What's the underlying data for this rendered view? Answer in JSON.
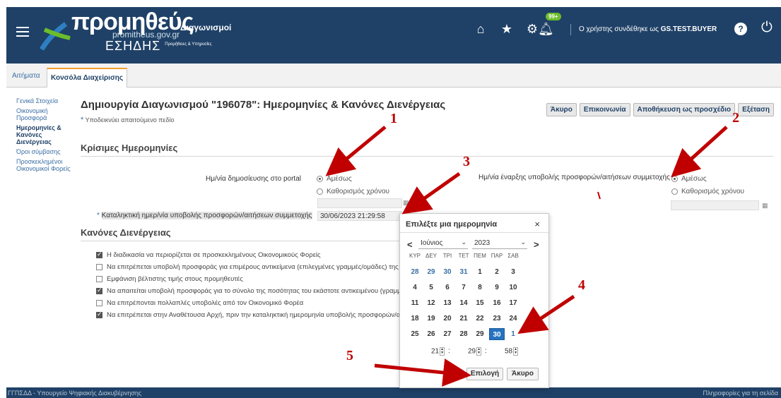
{
  "header": {
    "logo_main": "προμηθεύς",
    "logo_sub": "Διαγωνισμοί",
    "logo_url": "promitheus.gov.gr",
    "logo_esidis": "ΕΣΗΔΗΣ",
    "logo_esidis_small": "Προμήθειες & Υπηρεσίες",
    "notification_badge": "99+",
    "user_prefix": "Ο χρήστης συνδέθηκε ως ",
    "user_name": "GS.TEST.BUYER",
    "help_label": "?",
    "icons": [
      "home-icon",
      "star-icon",
      "gear-icon",
      "bell-icon",
      "help-icon",
      "power-icon"
    ]
  },
  "tabs": [
    {
      "label": "Αιτήματα"
    },
    {
      "label": "Κονσόλα Διαχείρισης",
      "active": true
    }
  ],
  "sidebar": {
    "items": [
      {
        "label": "Γενικά Στοιχεία"
      },
      {
        "label": "Οικονομική Προσφορά"
      },
      {
        "label": "Ημερομηνίες & Κανόνες Διενέργειας",
        "current": true
      },
      {
        "label": "Όροι σύμβασης"
      },
      {
        "label": "Προσκεκλημένοι Οικονομικοί Φορείς"
      }
    ]
  },
  "page": {
    "title": "Δημιουργία Διαγωνισμού \"196078\": Ημερομηνίες & Κανόνες Διενέργειας",
    "required_note": "Υποδεικνύει απαιτούμενο πεδίο",
    "buttons": {
      "cancel": "Άκυρο",
      "contact": "Επικοινωνία",
      "save_draft": "Αποθήκευση ως προσχέδιο",
      "review": "Εξέταση"
    }
  },
  "key_dates": {
    "heading": "Κρίσιμες Ημερομηνίες",
    "publish_label": "Ημ/νία δημοσίευσης στο portal",
    "submit_start_label": "Ημ/νία έναρξης υποβολής προσφορών/αιτήσεων συμμετοχής",
    "option_immediate": "Αμέσως",
    "option_scheduled": "Καθορισμός χρόνου",
    "deadline_label": "Καταληκτική ημερ/νία υποβολής προσφορών/αιτήσεων συμμετοχής",
    "deadline_value": "30/06/2023 21:29:58"
  },
  "rules": {
    "heading": "Κανόνες Διενέργειας",
    "items": [
      {
        "label": "Η διαδικασία να περιορίζεται σε προσκεκλημένους Οικονομικούς Φορείς",
        "checked": true
      },
      {
        "label": "Να επιτρέπεται υποβολή προσφοράς για επιμέρους αντικείμενα (επιλεγμένες γραμμές/ομάδες) της διαδικ",
        "checked": false
      },
      {
        "label": "Εμφάνιση βέλτιστης τιμής στους προμηθευτές",
        "checked": false
      },
      {
        "label": "Να απαιτείται υποβολή προσφοράς για το σύνολο της ποσότητας του εκάστοτε αντικειμένου (γραμμή)",
        "checked": true
      },
      {
        "label": "Να επιτρέπονται πολλαπλές υποβολές από τον Οικονομικό Φορέα",
        "checked": false
      },
      {
        "label": "Να επιτρέπεται στην Αναθέτουσα Αρχή, πριν την καταληκτική ημερομηνία υποβολής προσφορών/αιτήσει",
        "checked": true
      }
    ]
  },
  "datepicker": {
    "title": "Επιλέξτε μια ημερομηνία",
    "close": "×",
    "prev": "<",
    "next": ">",
    "month": "Ιούνιος",
    "year": "2023",
    "weekdays": [
      "ΚΥΡ",
      "ΔΕΥ",
      "ΤΡΙ",
      "ΤΕΤ",
      "ΠΕΜ",
      "ΠΑΡ",
      "ΣΑΒ"
    ],
    "weeks": [
      [
        "28",
        "29",
        "30",
        "31",
        "1",
        "2",
        "3"
      ],
      [
        "4",
        "5",
        "6",
        "7",
        "8",
        "9",
        "10"
      ],
      [
        "11",
        "12",
        "13",
        "14",
        "15",
        "16",
        "17"
      ],
      [
        "18",
        "19",
        "20",
        "21",
        "22",
        "23",
        "24"
      ],
      [
        "25",
        "26",
        "27",
        "28",
        "29",
        "30",
        "1"
      ]
    ],
    "selected_day": "30",
    "hour": "21",
    "minute": "29",
    "second": "58",
    "select_button": "Επιλογή",
    "cancel_button": "Άκυρο"
  },
  "annotations": [
    "1",
    "2",
    "3",
    "4",
    "5"
  ],
  "footer": {
    "left": "ΓΓΠΣΔΔ - Υπουργείο Ψηφιακής Διακυβέρνησης",
    "right": "Πληροφορίες για τη σελίδα"
  },
  "colors": {
    "header_bg": "#1f4167",
    "annotation_red": "#c00000",
    "selected_day": "#2673c0"
  }
}
